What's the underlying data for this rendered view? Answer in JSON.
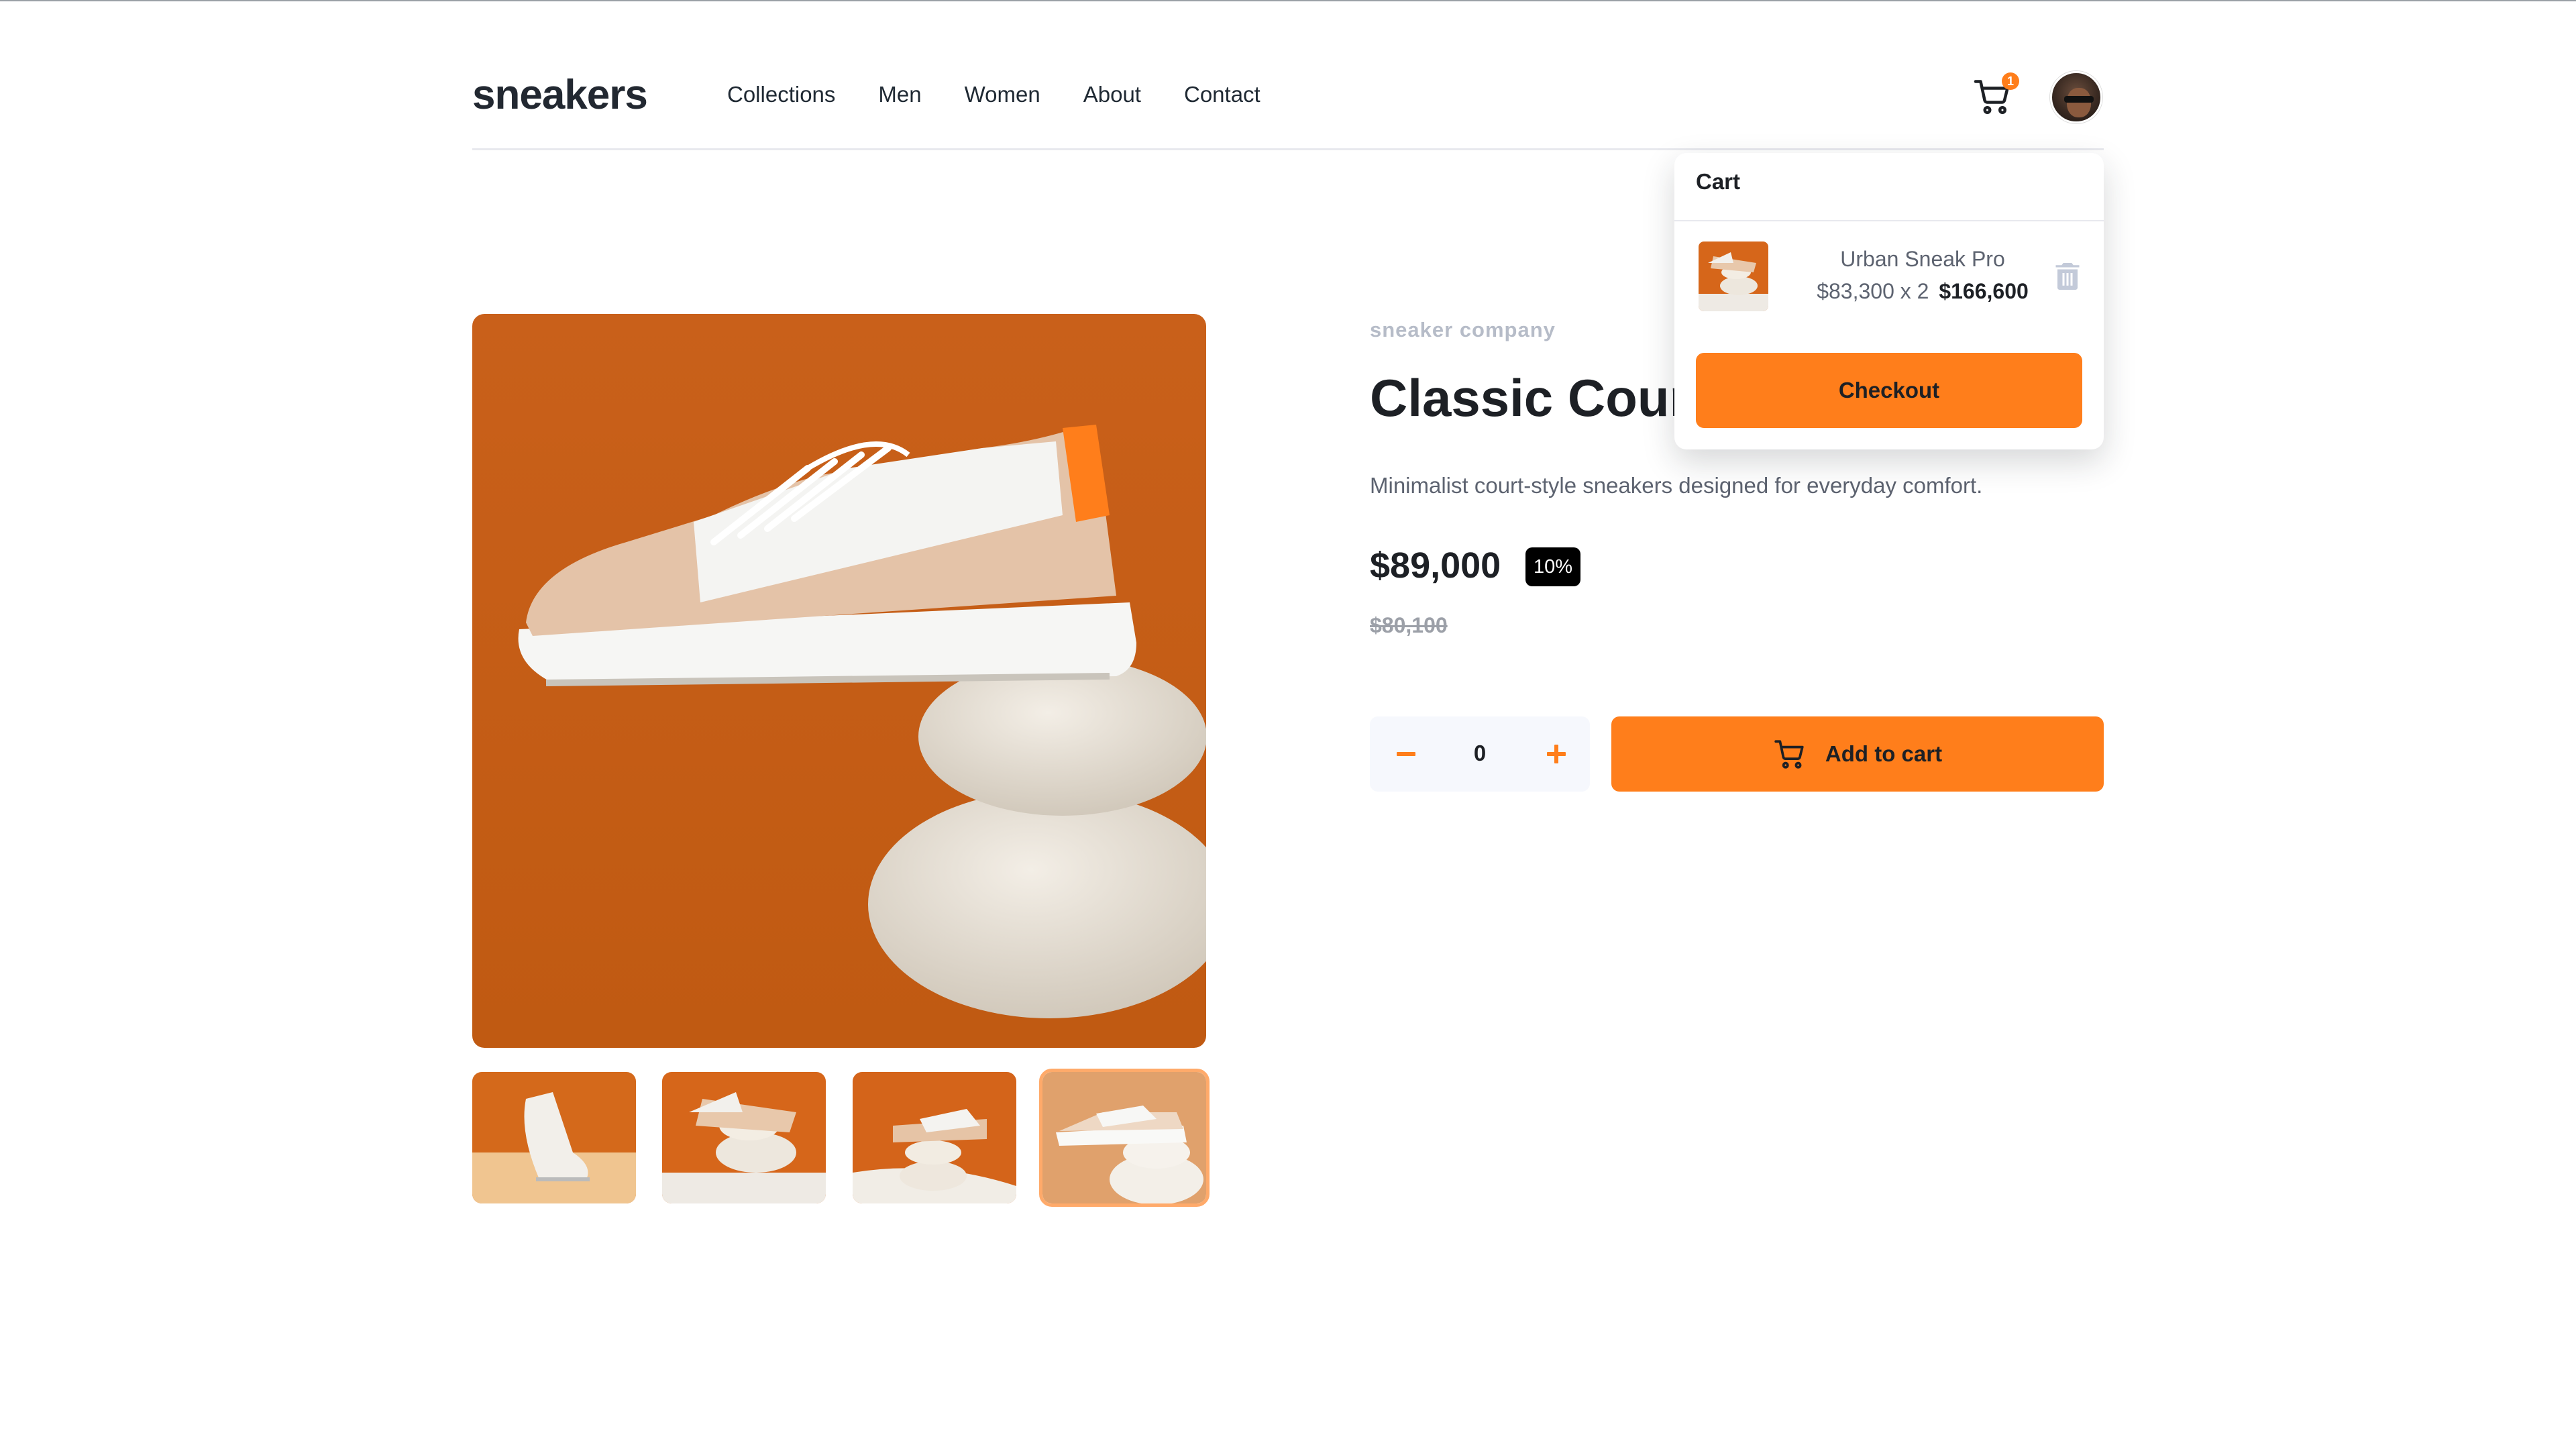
{
  "header": {
    "logo": "sneakers",
    "nav": [
      "Collections",
      "Men",
      "Women",
      "About",
      "Contact"
    ],
    "cart_count": "1"
  },
  "product": {
    "company": "sneaker company",
    "title": "Classic Court",
    "description": "Minimalist court-style sneakers designed for everyday comfort.",
    "price": "$89,000",
    "discount": "10%",
    "original_price": "$80,100",
    "quantity": "0",
    "add_to_cart_label": "Add to cart"
  },
  "gallery": {
    "thumbnail_count": 4,
    "active_thumbnail_index": 3
  },
  "cart": {
    "title": "Cart",
    "items": [
      {
        "name": "Urban Sneak Pro",
        "unit_price_qty": "$83,300 x 2",
        "total": "$166,600"
      }
    ],
    "checkout_label": "Checkout"
  },
  "colors": {
    "accent": "#ff7e1b",
    "text_dark": "#1d2025",
    "text_muted": "#5d6370",
    "image_bg": "#cc5f11"
  }
}
